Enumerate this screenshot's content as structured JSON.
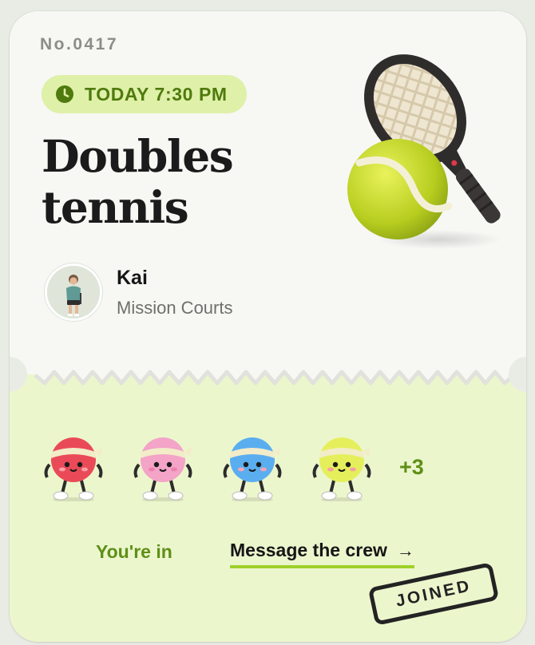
{
  "ticket": {
    "number": "No.0417",
    "time_label": "TODAY 7:30 PM",
    "title_line1": "Doubles",
    "title_line2": "tennis",
    "host": {
      "name": "Kai",
      "location": "Mission Courts"
    }
  },
  "crew": {
    "players": [
      {
        "icon": "red-ball-mascot-icon",
        "color": "#ea4a57"
      },
      {
        "icon": "pink-ball-mascot-icon",
        "color": "#f3a4c7"
      },
      {
        "icon": "blue-ball-mascot-icon",
        "color": "#5aaef0"
      },
      {
        "icon": "yellow-ball-mascot-icon",
        "color": "#e5ef5c"
      }
    ],
    "more_count": "+3",
    "status": "You're in",
    "message_label": "Message the crew",
    "message_arrow": "→",
    "stamp": "JOINED"
  },
  "colors": {
    "accent": "#9ed12a",
    "accent_dark": "#5e8f17",
    "pill_bg": "#dff0a8",
    "bottom_bg": "#ecf6cd",
    "card_bg": "#f7f7f4"
  },
  "icons": {
    "clock": "clock-icon",
    "hero": "tennis-racket-and-ball-icon",
    "arrow": "arrow-right-icon"
  }
}
